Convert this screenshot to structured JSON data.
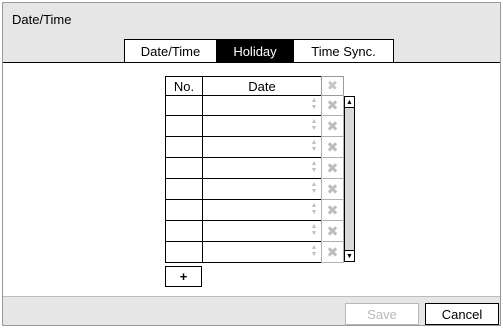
{
  "dialog": {
    "title": "Date/Time"
  },
  "tabs": [
    {
      "label": "Date/Time",
      "active": false
    },
    {
      "label": "Holiday",
      "active": true
    },
    {
      "label": "Time Sync.",
      "active": false
    }
  ],
  "table": {
    "columns": {
      "no": "No.",
      "date": "Date",
      "delete_icon": "x-icon"
    },
    "rows": [
      {
        "no": "",
        "date": ""
      },
      {
        "no": "",
        "date": ""
      },
      {
        "no": "",
        "date": ""
      },
      {
        "no": "",
        "date": ""
      },
      {
        "no": "",
        "date": ""
      },
      {
        "no": "",
        "date": ""
      },
      {
        "no": "",
        "date": ""
      },
      {
        "no": "",
        "date": ""
      }
    ]
  },
  "add_button": {
    "label": "+"
  },
  "footer": {
    "save_label": "Save",
    "cancel_label": "Cancel"
  }
}
